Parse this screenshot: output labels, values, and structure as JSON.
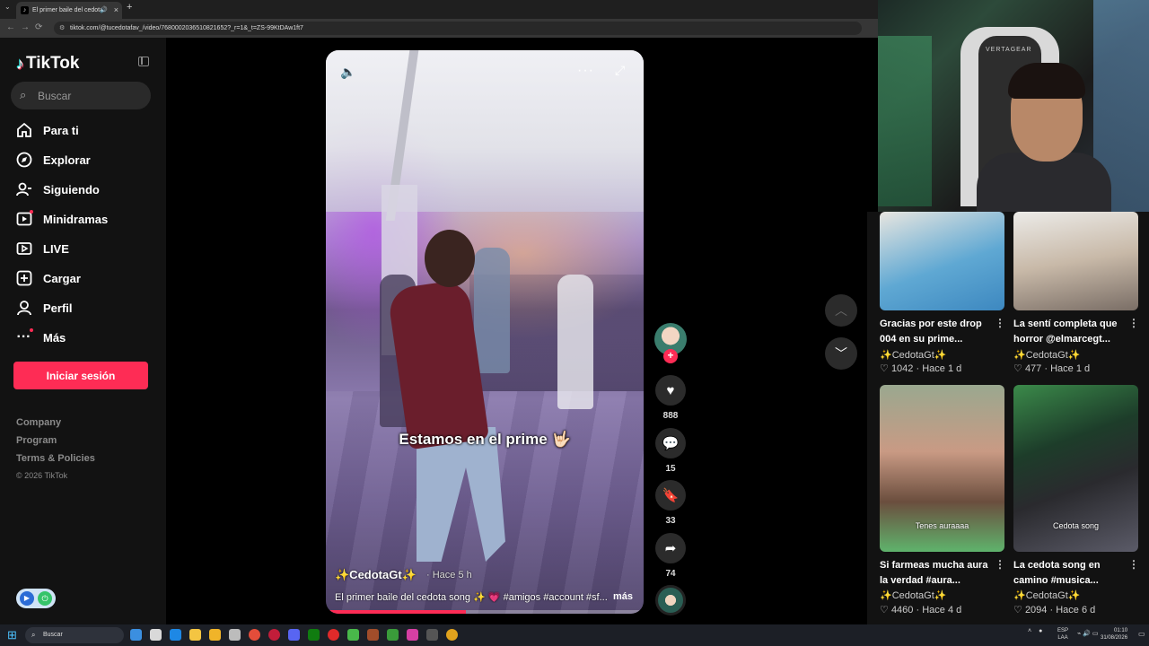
{
  "browser": {
    "tab_title": "El primer baile del cedota",
    "url": "tiktok.com/@tucedotafav_/video/76800020365108216​52?_r=1&_t=ZS-99KtDAw1ft7"
  },
  "sidebar": {
    "brand": "TikTok",
    "search_placeholder": "Buscar",
    "nav": [
      {
        "label": "Para ti",
        "icon": "home-icon"
      },
      {
        "label": "Explorar",
        "icon": "compass-icon"
      },
      {
        "label": "Siguiendo",
        "icon": "following-icon"
      },
      {
        "label": "Minidramas",
        "icon": "film-icon"
      },
      {
        "label": "LIVE",
        "icon": "live-icon"
      },
      {
        "label": "Cargar",
        "icon": "upload-icon"
      },
      {
        "label": "Perfil",
        "icon": "profile-icon"
      },
      {
        "label": "Más",
        "icon": "more-dots-icon"
      }
    ],
    "login_label": "Iniciar sesión",
    "footer": [
      "Company",
      "Program",
      "Terms & Policies"
    ],
    "copyright": "© 2026 TikTok"
  },
  "video": {
    "caption_overlay": "Estamos en el prime 🤟🏻",
    "author": "✨CedotaGt✨",
    "posted": "Hace 5 h",
    "description": "El primer baile del cedota song ✨ 💗 #amigos #account #sf...",
    "more_label": "más",
    "progress": 0.44
  },
  "actions": {
    "likes": "888",
    "comments": "15",
    "saves": "33",
    "shares": "74"
  },
  "related": [
    {
      "title": "Gracias por este drop 004 en su prime...",
      "author": "✨CedotaGt✨",
      "likes": "1042",
      "posted": "Hace 1 d"
    },
    {
      "title": "La sentí completa que horror @elmarcegt...",
      "author": "✨CedotaGt✨",
      "likes": "477",
      "posted": "Hace 1 d"
    },
    {
      "title": "Si farmeas mucha aura la verdad #aura...",
      "author": "✨CedotaGt✨",
      "likes": "4460",
      "posted": "Hace 4 d",
      "thumb_caption": "Tenes auraaaa"
    },
    {
      "title": "La cedota song en camino #musica...",
      "author": "✨CedotaGt✨",
      "likes": "2094",
      "posted": "Hace 6 d",
      "thumb_caption": "Cedota song"
    }
  ],
  "webcam": {
    "chair_brand": "VERTAGEAR"
  },
  "taskbar": {
    "search_placeholder": "Buscar",
    "lang_line1": "ESP",
    "lang_line2": "LAA",
    "time": "01:10",
    "date": "31/08/2026"
  },
  "colors": {
    "accent": "#fe2c55",
    "background": "#121212"
  }
}
